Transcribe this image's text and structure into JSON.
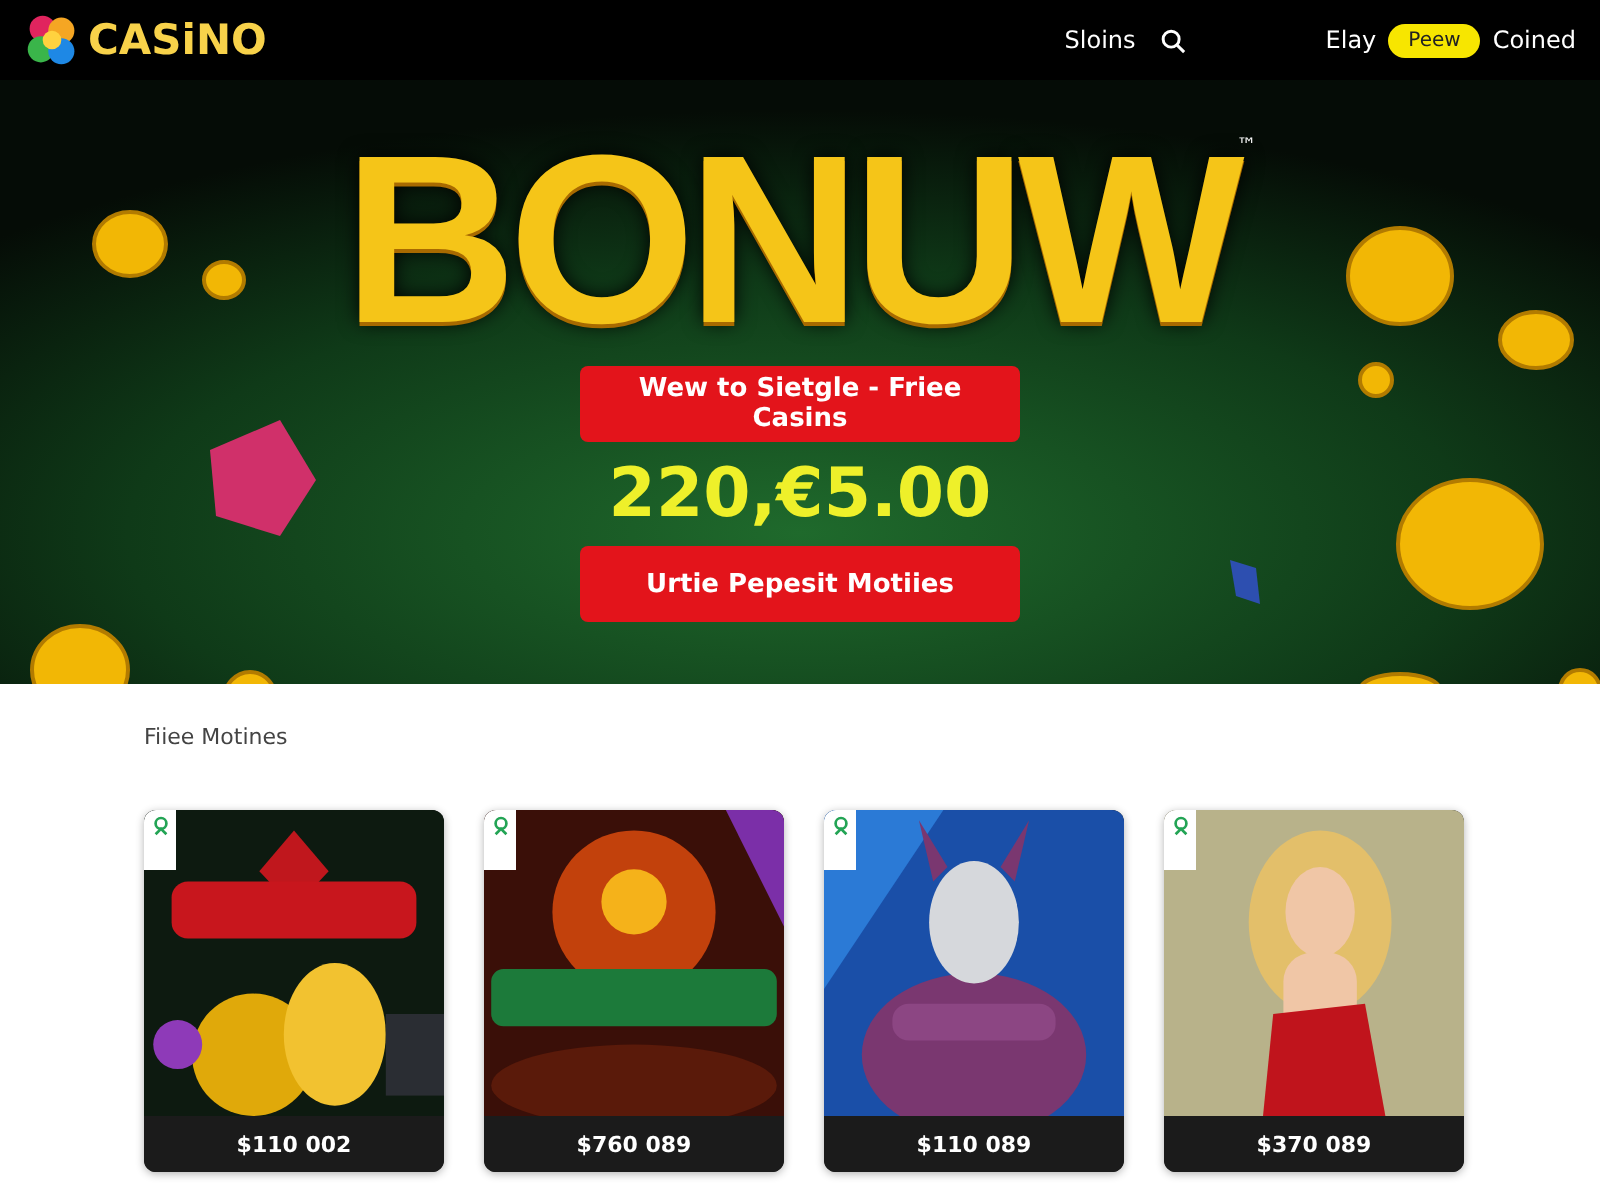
{
  "header": {
    "logo": "CASiNO",
    "nav_link": "Sloins",
    "account_link": "Elay",
    "pill_button": "Peew",
    "signup_link": "Coined"
  },
  "hero": {
    "title": "BONUW",
    "trademark": "™",
    "promo_button": "Wew to Sietgle - Friee Casins",
    "amount": "220,€5.00",
    "cta_button": "Urtie Pepesit Motiies"
  },
  "games_section": {
    "title": "Fiiee Motines",
    "games": [
      {
        "kind": "coins",
        "price": "$110 002"
      },
      {
        "kind": "fire",
        "price": "$760 089"
      },
      {
        "kind": "masked",
        "price": "$110 089"
      },
      {
        "kind": "figure",
        "price": "$370 089"
      }
    ]
  }
}
